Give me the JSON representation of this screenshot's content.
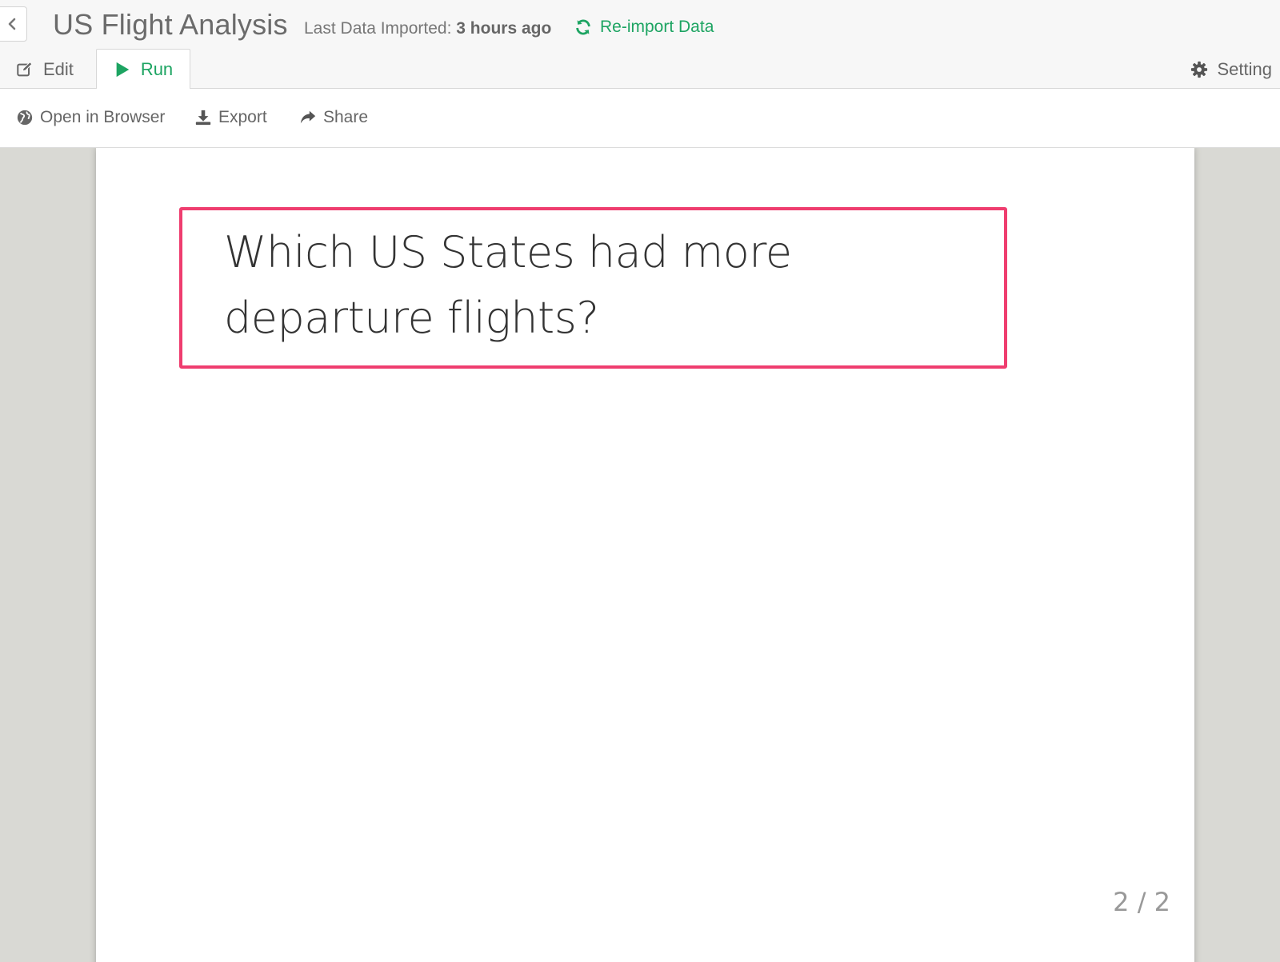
{
  "header": {
    "title": "US Flight Analysis",
    "import_label": "Last Data Imported:",
    "import_time": "3 hours ago",
    "reimport_label": "Re-import Data"
  },
  "tabs": {
    "edit_label": "Edit",
    "run_label": "Run",
    "setting_label": "Setting",
    "active": "Run"
  },
  "toolbar": {
    "open_label": "Open in Browser",
    "export_label": "Export",
    "share_label": "Share"
  },
  "slide": {
    "question": "Which US States had more departure flights?",
    "page_indicator": "2 / 2"
  },
  "colors": {
    "accent_green": "#1da462",
    "highlight_pink": "#ef3d6f",
    "canvas_bg": "#d9d9d4"
  },
  "icons": {
    "back": "chevron-left-icon",
    "reimport": "refresh-icon",
    "edit": "edit-icon",
    "run": "play-icon",
    "setting": "gear-icon",
    "open": "globe-icon",
    "export": "download-icon",
    "share": "share-icon"
  }
}
